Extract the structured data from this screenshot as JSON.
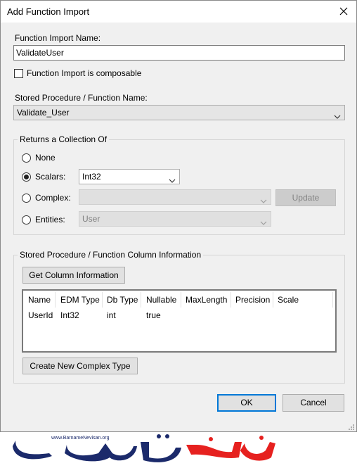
{
  "window": {
    "title": "Add Function Import"
  },
  "function_import_name": {
    "label": "Function Import Name:",
    "value": "ValidateUser"
  },
  "composable": {
    "label": "Function Import is composable",
    "checked": false
  },
  "stored_procedure": {
    "label": "Stored Procedure / Function Name:",
    "value": "Validate_User"
  },
  "returns": {
    "group_title": "Returns a Collection Of",
    "none_label": "None",
    "scalars_label": "Scalars:",
    "scalars_value": "Int32",
    "complex_label": "Complex:",
    "complex_value": "",
    "update_label": "Update",
    "entities_label": "Entities:",
    "entities_value": "User",
    "selected": "scalars"
  },
  "column_info": {
    "group_title": "Stored Procedure / Function Column Information",
    "get_button": "Get Column Information",
    "columns": [
      "Name",
      "EDM Type",
      "Db Type",
      "Nullable",
      "MaxLength",
      "Precision",
      "Scale"
    ],
    "rows": [
      [
        "UserId",
        "Int32",
        "int",
        "true",
        "",
        "",
        ""
      ]
    ],
    "create_button": "Create New Complex Type"
  },
  "footer": {
    "ok_label": "OK",
    "cancel_label": "Cancel"
  },
  "watermark": {
    "url": "www.BarnameNevisan.org",
    "text": "برنامه نویسان"
  },
  "colors": {
    "accent": "#0078d7",
    "watermark_red": "#e6211f",
    "watermark_navy": "#1b2a6b"
  }
}
